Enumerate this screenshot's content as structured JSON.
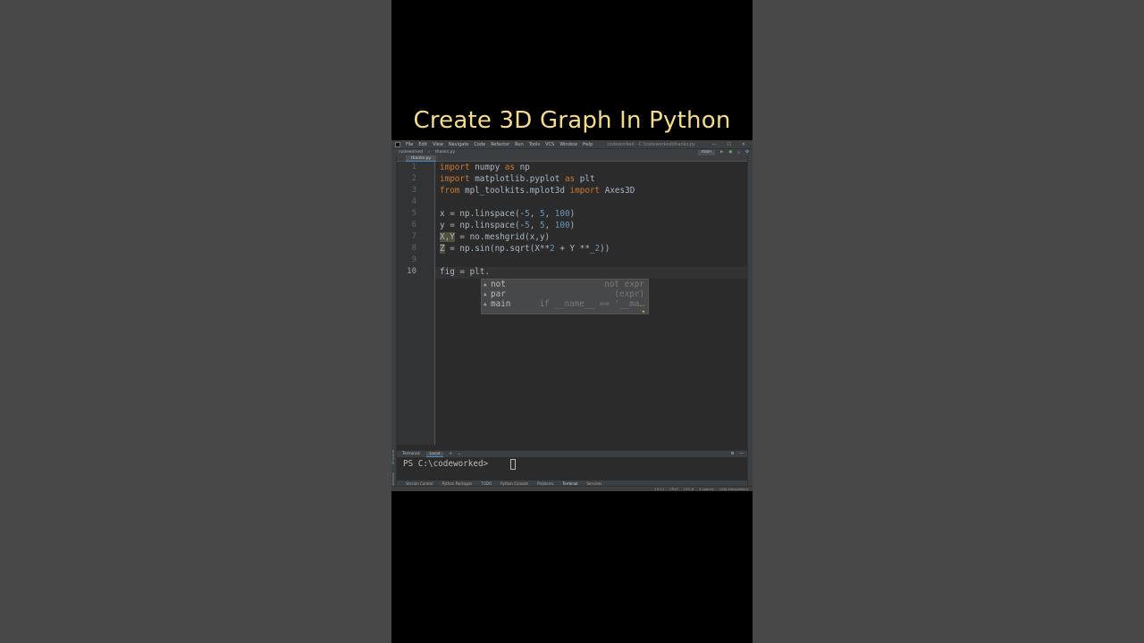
{
  "headline": "Create 3D Graph In Python",
  "ide": {
    "menu": [
      "File",
      "Edit",
      "View",
      "Navigate",
      "Code",
      "Refactor",
      "Run",
      "Tools",
      "VCS",
      "Window",
      "Help"
    ],
    "window_title": "codeworked - C:\\codeworked\\thanks.py",
    "window_buttons": [
      "—",
      "☐",
      "✕"
    ],
    "breadcrumb": [
      "codeworked",
      "thanks.py"
    ],
    "run_config": "main",
    "tab": "thanks.py",
    "lines": [
      {
        "num": "1",
        "text": "import numpy as np"
      },
      {
        "num": "2",
        "text": "import matplotlib.pyplot as plt"
      },
      {
        "num": "3",
        "text": "from mpl_toolkits.mplot3d import Axes3D"
      },
      {
        "num": "4",
        "text": ""
      },
      {
        "num": "5",
        "text": "x = np.linspace(-5, 5, 100)"
      },
      {
        "num": "6",
        "text": "y = np.linspace(-5, 5, 100)"
      },
      {
        "num": "7",
        "text": "X,Y = no.meshgrid(x,y)"
      },
      {
        "num": "8",
        "text": "Z = np.sin(np.sqrt(X**2 + Y **_2))"
      },
      {
        "num": "9",
        "text": ""
      },
      {
        "num": "10",
        "text": "fig = plt."
      }
    ],
    "autocomplete": [
      {
        "label": "not",
        "hint": "not expr"
      },
      {
        "label": "par",
        "hint": "(expr)"
      },
      {
        "label": "main",
        "hint": "if __name__ == '__ma…"
      }
    ],
    "terminal_title": "Terminal:",
    "terminal_tab": "Local",
    "terminal_prompt": "PS C:\\codeworked> ",
    "tool_windows": [
      "Version Control",
      "Python Packages",
      "TODO",
      "Python Console",
      "Problems",
      "Terminal",
      "Services"
    ],
    "active_tool_window": "Terminal",
    "status": [
      "10:11",
      "CRLF",
      "UTF-8",
      "4 spaces",
      "<No interpreter>"
    ],
    "left_side_labels": [
      "Structure",
      "Bookmarks"
    ],
    "colors": {
      "keyword": "#cc7832",
      "number": "#6897bb",
      "text": "#a9b7c6",
      "headline": "#f3dc8c"
    }
  }
}
